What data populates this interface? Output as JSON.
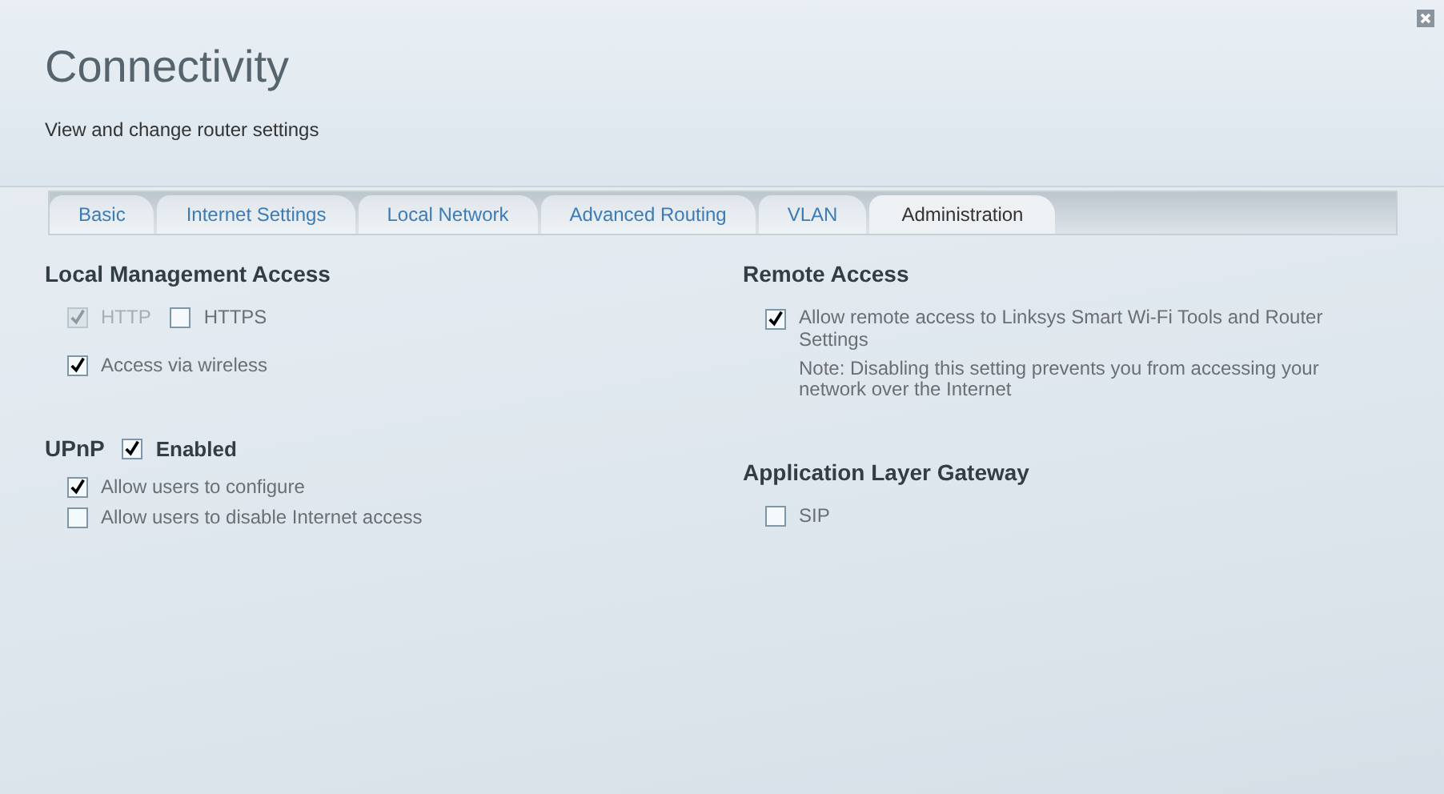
{
  "header": {
    "title": "Connectivity",
    "subtitle": "View and change router settings"
  },
  "tabs": [
    {
      "label": "Basic",
      "selected": false
    },
    {
      "label": "Internet Settings",
      "selected": false
    },
    {
      "label": "Local Network",
      "selected": false
    },
    {
      "label": "Advanced Routing",
      "selected": false
    },
    {
      "label": "VLAN",
      "selected": false
    },
    {
      "label": "Administration",
      "selected": true
    }
  ],
  "local_management_access": {
    "title": "Local Management Access",
    "options": [
      {
        "label": "HTTP",
        "checked": true,
        "disabled": true
      },
      {
        "label": "HTTPS",
        "checked": false,
        "disabled": false
      }
    ],
    "wireless": {
      "label": "Access via wireless",
      "checked": true,
      "disabled": false
    }
  },
  "upnp": {
    "title": "UPnP",
    "enabled": {
      "label": "Enabled",
      "checked": true
    },
    "options": [
      {
        "label": "Allow users to configure",
        "checked": true,
        "disabled": false
      },
      {
        "label": "Allow users to disable Internet access",
        "checked": false,
        "disabled": false
      }
    ]
  },
  "remote_access": {
    "title": "Remote Access",
    "option": {
      "label": "Allow remote access to Linksys Smart Wi-Fi Tools and Router Settings",
      "checked": true,
      "disabled": false
    },
    "note": "Note: Disabling this setting prevents you from accessing your network over the Internet"
  },
  "application_layer_gateway": {
    "title": "Application Layer Gateway",
    "options": [
      {
        "label": "SIP",
        "checked": false,
        "disabled": false
      }
    ]
  }
}
